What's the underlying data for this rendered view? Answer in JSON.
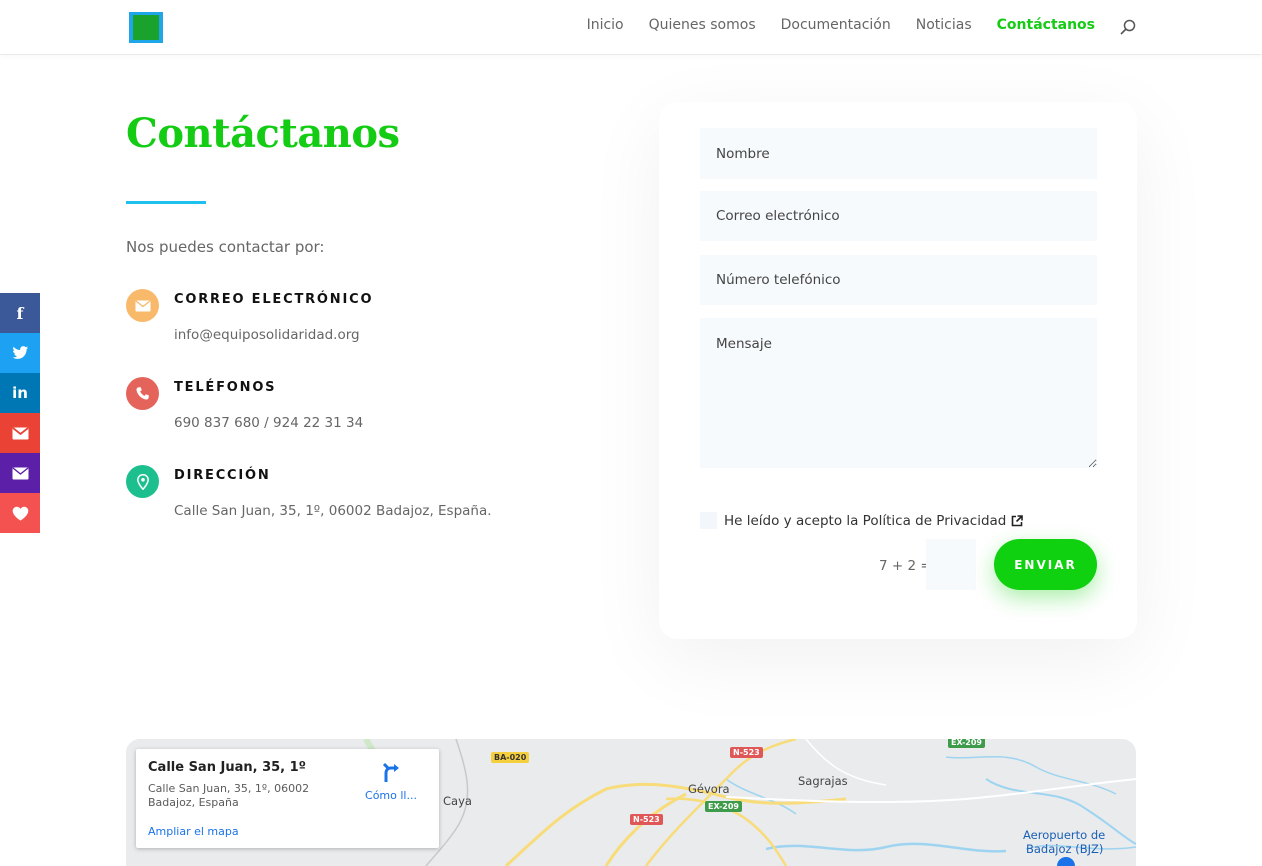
{
  "nav": {
    "items": [
      {
        "label": "Inicio",
        "active": false
      },
      {
        "label": "Quienes somos",
        "active": false
      },
      {
        "label": "Documentación",
        "active": false
      },
      {
        "label": "Noticias",
        "active": false
      },
      {
        "label": "Contáctanos",
        "active": true
      }
    ],
    "search_icon": "search-icon"
  },
  "page": {
    "title": "Contáctanos",
    "intro": "Nos puedes contactar por:",
    "accent": "#14cc14"
  },
  "contacts": [
    {
      "icon": "envelope-icon",
      "color": "#f9b96a",
      "label": "CORREO ELECTRÓNICO",
      "value": "info@equiposolidaridad.org"
    },
    {
      "icon": "phone-icon",
      "color": "#e4645b",
      "label": "TELÉFONOS",
      "value": "690 837 680 / 924 22 31 34"
    },
    {
      "icon": "location-pin-icon",
      "color": "#1dbf8e",
      "label": "DIRECCIÓN",
      "value": "Calle San Juan, 35, 1º, 06002 Badajoz, España."
    }
  ],
  "social": [
    {
      "name": "facebook",
      "icon": "facebook-icon",
      "glyph": "f",
      "color": "#3b5998"
    },
    {
      "name": "twitter",
      "icon": "twitter-icon",
      "glyph": "",
      "color": "#1da1f2"
    },
    {
      "name": "linkedin",
      "icon": "linkedin-icon",
      "glyph": "in",
      "color": "#0077b5"
    },
    {
      "name": "gmail",
      "icon": "gmail-icon",
      "glyph": "",
      "color": "#ea4335"
    },
    {
      "name": "email",
      "icon": "email-icon",
      "glyph": "",
      "color": "#5b1fa8"
    },
    {
      "name": "favorite",
      "icon": "heart-icon",
      "glyph": "",
      "color": "#f45151"
    }
  ],
  "form": {
    "name_placeholder": "Nombre",
    "email_placeholder": "Correo electrónico",
    "phone_placeholder": "Número telefónico",
    "message_placeholder": "Mensaje",
    "consent_text": "He leído y acepto la Política de Privacidad",
    "captcha_label": "7 + 2 =",
    "submit_label": "ENVIAR"
  },
  "map": {
    "place_title": "Calle San Juan, 35, 1º",
    "address_line1": "Calle San Juan, 35, 1º, 06002",
    "address_line2": "Badajoz, España",
    "enlarge_link": "Ampliar el mapa",
    "directions_label": "Cómo ll...",
    "labels": {
      "caya": "Caya",
      "gevora": "Gévora",
      "sagrajas": "Sagrajas",
      "airport_line1": "Aeropuerto de",
      "airport_line2": "Badajoz (BJZ)"
    },
    "shields": {
      "ba020": "BA-020",
      "n523_a": "N-523",
      "n523_b": "N-523",
      "ex209_a": "EX-209",
      "ex209_b": "EX-209"
    }
  }
}
